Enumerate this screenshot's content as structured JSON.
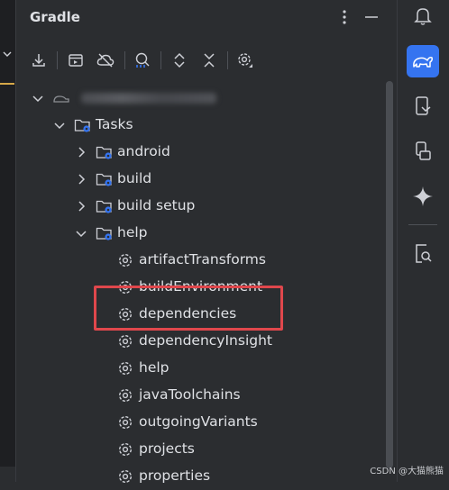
{
  "panel": {
    "title": "Gradle"
  },
  "toolbar": {
    "buttons": [
      "download-icon",
      "run-config-icon",
      "offline-cloud-icon",
      "analyze-icon",
      "expand-all-icon",
      "collapse-all-icon",
      "settings-icon"
    ]
  },
  "tree": {
    "root_label_blurred": true,
    "tasks_label": "Tasks",
    "groups": [
      "android",
      "build",
      "build setup",
      "help"
    ],
    "help_tasks": [
      "artifactTransforms",
      "buildEnvironment",
      "dependencies",
      "dependencyInsight",
      "help",
      "javaToolchains",
      "outgoingVariants",
      "projects",
      "properties"
    ]
  },
  "highlight": {
    "target": "dependencies",
    "color": "#e0474c"
  },
  "right_toolbar": {
    "icons": [
      "notifications-icon",
      "gradle-icon",
      "device-manager-icon",
      "running-devices-icon",
      "gemini-icon",
      "app-inspection-icon"
    ],
    "active": "gradle-icon"
  },
  "watermark": "CSDN @大猫熊猫",
  "colors": {
    "background": "#2b2d30",
    "text": "#dfe1e5",
    "accent": "#3574f0",
    "folder_badge": "#3574f0",
    "highlight": "#e0474c"
  }
}
